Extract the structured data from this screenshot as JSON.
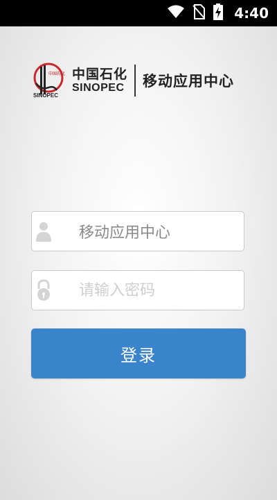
{
  "status_bar": {
    "time": "4:40",
    "icons": [
      "wifi-icon",
      "no-sim-icon",
      "battery-charging-icon"
    ]
  },
  "brand": {
    "company_cn": "中国石化",
    "company_en": "SINOPEC",
    "app_name": "移动应用中心",
    "logo_text": "中国石化 SINOPEC"
  },
  "login": {
    "username": {
      "value": "移动应用中心",
      "icon": "user-icon"
    },
    "password": {
      "placeholder": "请输入密码",
      "icon": "lock-icon"
    },
    "button_label": "登录"
  },
  "colors": {
    "status_bar": "#000000",
    "button": "#3a84cc",
    "logo_red": "#c8282d"
  }
}
